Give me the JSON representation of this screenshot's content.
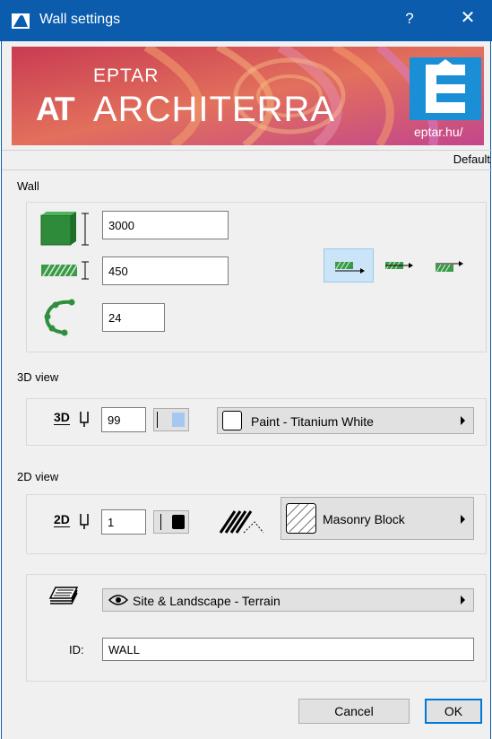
{
  "window": {
    "title": "Wall settings",
    "help_label": "?",
    "close_label": "✕"
  },
  "banner": {
    "brand_small": "EPTAR",
    "brand_large": "ARCHITERRA",
    "brand_mark": "AT",
    "logo_url": "eptar.hu/"
  },
  "preset": "Default",
  "wall": {
    "section_label": "Wall",
    "height": "3000",
    "thickness": "450",
    "segments": "24"
  },
  "view3d": {
    "section_label": "3D view",
    "badge": "3D",
    "pen": "99",
    "swatch_color": "#a6c8f0",
    "material": "Paint - Titanium White"
  },
  "view2d": {
    "section_label": "2D view",
    "badge": "2D",
    "pen": "1",
    "swatch_color": "#000000",
    "fill": "Masonry Block"
  },
  "layer": {
    "name": "Site & Landscape - Terrain",
    "id_label": "ID:",
    "id_value": "WALL"
  },
  "buttons": {
    "cancel": "Cancel",
    "ok": "OK"
  },
  "colors": {
    "titlebar": "#0b5cad",
    "selection": "#cce4f7",
    "accent": "#0078d7"
  }
}
